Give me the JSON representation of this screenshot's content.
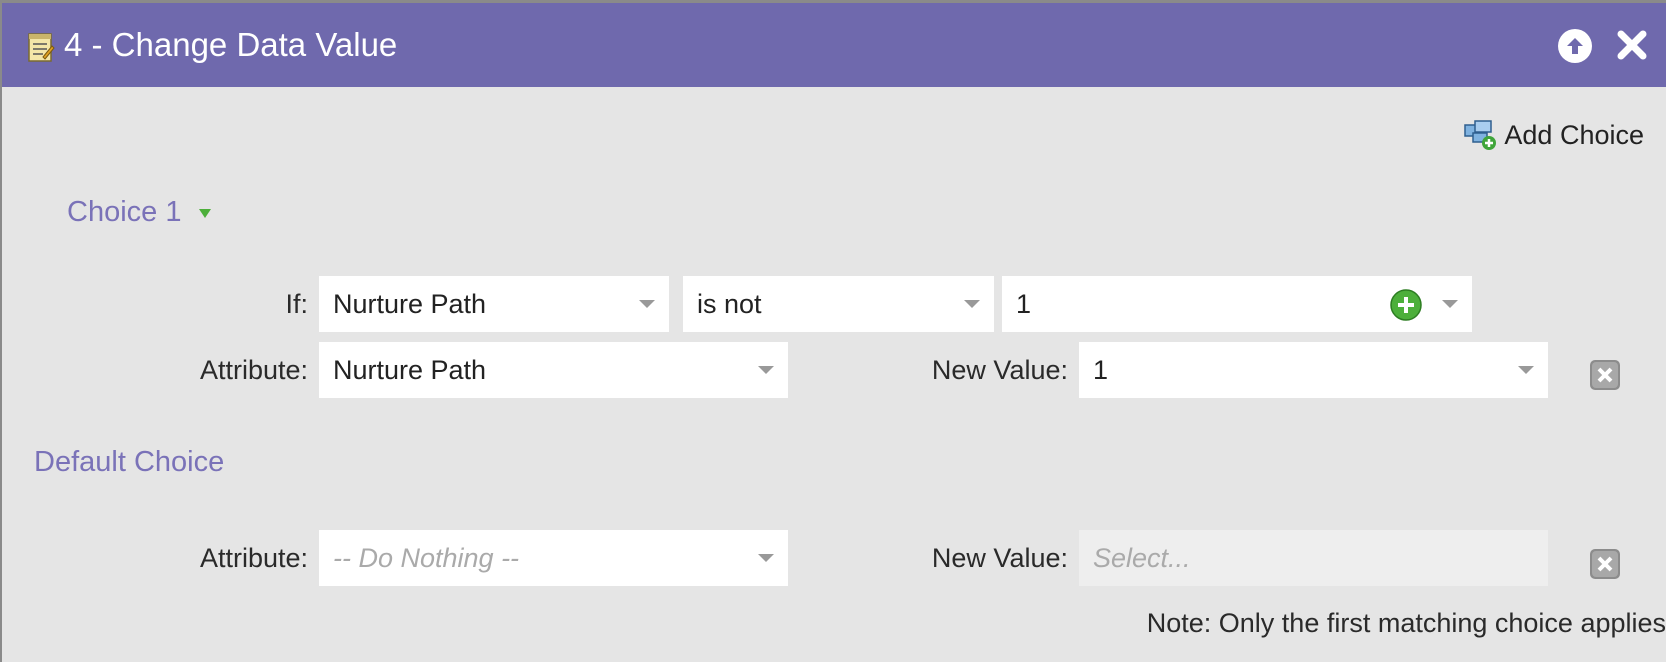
{
  "dialog": {
    "title": "4 - Change Data Value",
    "title_icon": "notepad-icon",
    "collapse_icon": "arrow-up-circle-icon",
    "close_icon": "close-icon"
  },
  "toolbar": {
    "add_choice_label": "Add Choice",
    "add_choice_icon": "add-choice-icon"
  },
  "choice1": {
    "title": "Choice 1",
    "if_label": "If:",
    "condition_field": "Nurture Path",
    "condition_operator": "is not",
    "condition_value": "1",
    "attribute_label": "Attribute:",
    "attribute_value": "Nurture Path",
    "new_value_label": "New Value:",
    "new_value": "1"
  },
  "default_choice": {
    "title": "Default Choice",
    "attribute_label": "Attribute:",
    "attribute_placeholder": "-- Do Nothing --",
    "new_value_label": "New Value:",
    "new_value_placeholder": "Select..."
  },
  "note": "Note: Only the first matching choice applies",
  "colors": {
    "titlebar": "#6f69ad",
    "section_title": "#7a72b8",
    "panel_bg": "#e5e5e5",
    "plus_green": "#4caf3a"
  }
}
